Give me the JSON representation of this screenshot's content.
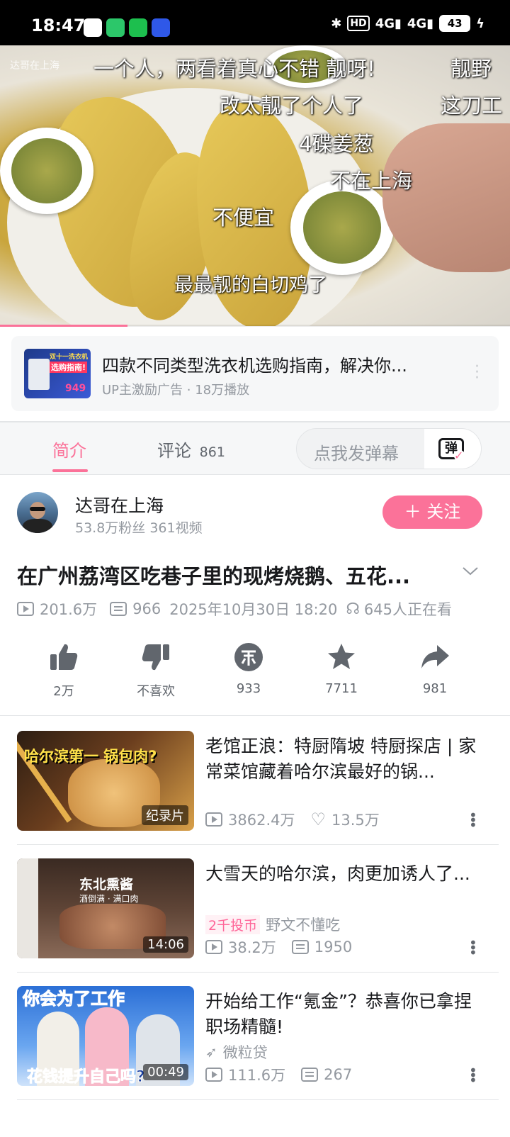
{
  "status_bar": {
    "time": "18:47",
    "hd": "HD",
    "net1": "4G",
    "net2": "4G",
    "battery": "43"
  },
  "video": {
    "watermark": "达哥在上海",
    "danmaku": [
      "一个人，两看着真心不错 靓呀!",
      "靓野",
      "改太靓了个人了",
      "这刀工",
      "4碟姜葱",
      "不在上海",
      "不便宜",
      "最最靓的白切鸡了"
    ],
    "progress_fraction": 0.25
  },
  "ad": {
    "title": "四款不同类型洗衣机选购指南，解决你...",
    "subtitle": "UP主激励广告 · 18万播放",
    "thumb_line1": "双十一洗衣机",
    "thumb_line2": "选购指南!",
    "thumb_price": "949"
  },
  "tabs": {
    "intro": "简介",
    "comments": "评论",
    "comments_count": "861",
    "danmaku_placeholder": "点我发弹幕",
    "danmaku_btn": "弹"
  },
  "uploader": {
    "name": "达哥在上海",
    "meta": "53.8万粉丝   361视频",
    "follow": "＋ 关注"
  },
  "video_info": {
    "title": "在广州荔湾区吃巷子里的现烤烧鹅、五花...",
    "views": "201.6万",
    "danmaku": "966",
    "date": "2025年10月30日 18:20",
    "watching": "645人正在看"
  },
  "actions": {
    "like": "2万",
    "dislike": "不喜欢",
    "coin": "933",
    "fav": "7711",
    "share": "981"
  },
  "recommendations": [
    {
      "title": "老馆正浪：特厨隋坡 特厨探店 | 家常菜馆藏着哈尔滨最好的锅...",
      "thumb_text": "哈尔滨第一 锅包肉?",
      "badge": "纪录片",
      "views": "3862.4万",
      "likes": "13.5万"
    },
    {
      "title": "大雪天的哈尔滨，肉更加诱人了...",
      "thumb_text": "东北熏酱",
      "thumb_sub": "酒倒满 · 满口肉",
      "badge": "14:06",
      "coin_tag": "2千投币",
      "author": "野文不懂吃",
      "views": "38.2万",
      "danmaku": "1950"
    },
    {
      "title": "开始给工作“氪金”？恭喜你已拿捏职场精髓!",
      "thumb_top": "你会为了工作",
      "thumb_bottom": "花钱提升自己吗?",
      "badge": "00:49",
      "author": "微粒贷",
      "views": "111.6万",
      "danmaku": "267"
    }
  ]
}
